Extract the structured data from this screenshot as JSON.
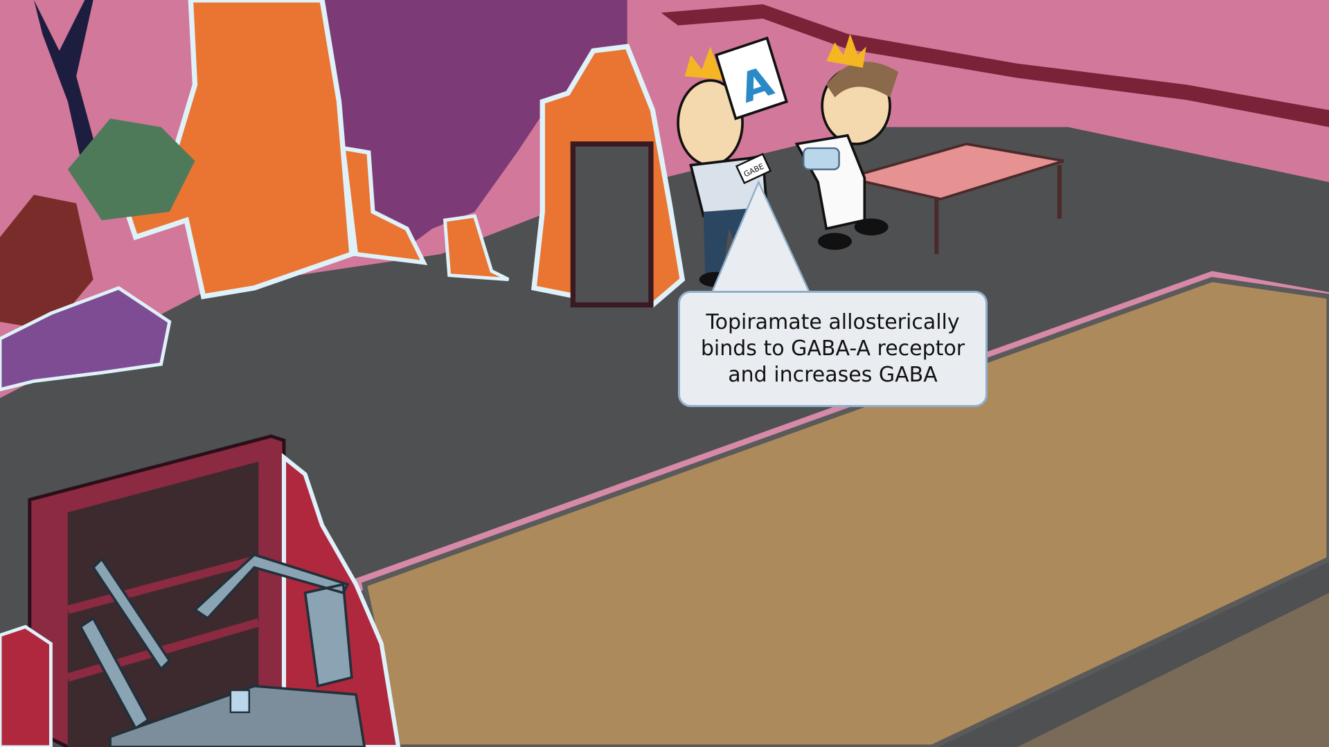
{
  "scene": {
    "speech_bubble": {
      "text": "Topiramate allosterically\nbinds to GABA-A receptor\nand increases GABA"
    },
    "name_tag": "GABE",
    "sign_letter": "A"
  },
  "colors": {
    "wall_pink": "#d2789a",
    "floor_gray": "#4e5052",
    "rug_tan": "#ad8a5c",
    "orange_wall": "#ea7432",
    "purple_wall": "#7c3b76",
    "bubble_fill": "#e9edf1",
    "bubble_border": "#8fb0cc"
  }
}
